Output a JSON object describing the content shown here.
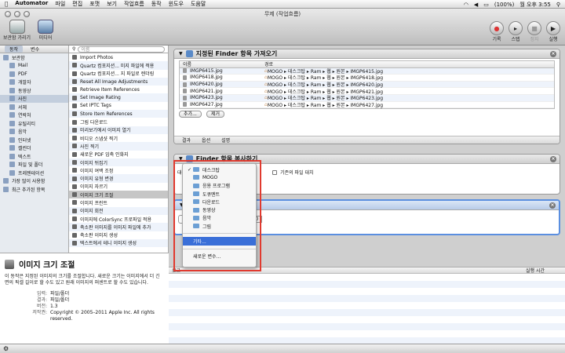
{
  "menubar": {
    "apple": "",
    "items": [
      "Automator",
      "파일",
      "편집",
      "포맷",
      "보기",
      "작업흐름",
      "동작",
      "윈도우",
      "도움말"
    ],
    "battery": "(100%)",
    "clock": "월 오후 3:55"
  },
  "window": {
    "title": "무제 (작업흐름)",
    "toolbar_left": [
      "보관함 가리기",
      "미디어"
    ],
    "toolbar_right": [
      "기록",
      "스텝",
      "정지",
      "실행"
    ]
  },
  "library": {
    "tabs": [
      "동작",
      "변수"
    ],
    "search_placeholder": "이름",
    "items": [
      {
        "label": "보관함",
        "indent": 0
      },
      {
        "label": "Mail",
        "indent": 1
      },
      {
        "label": "PDF",
        "indent": 1
      },
      {
        "label": "개발자",
        "indent": 1
      },
      {
        "label": "동영상",
        "indent": 1
      },
      {
        "label": "사진",
        "indent": 1,
        "selected": true
      },
      {
        "label": "서체",
        "indent": 1
      },
      {
        "label": "연락처",
        "indent": 1
      },
      {
        "label": "유틸리티",
        "indent": 1
      },
      {
        "label": "음악",
        "indent": 1
      },
      {
        "label": "인터넷",
        "indent": 1
      },
      {
        "label": "캘린더",
        "indent": 1
      },
      {
        "label": "텍스트",
        "indent": 1
      },
      {
        "label": "파일 및 폴더",
        "indent": 1
      },
      {
        "label": "프레젠테이션",
        "indent": 1
      },
      {
        "label": "가장 많이 사용함",
        "indent": 0
      },
      {
        "label": "최근 추가된 항목",
        "indent": 0
      }
    ]
  },
  "actions": [
    "Import Photos",
    "Quartz 컴포지션... 미지 파일에 적용",
    "Quartz 컴포지션... 지 파일로 렌더링",
    "Reset All Image Adjustments",
    "Retrieve Item References",
    "Set Image Rating",
    "Set IPTC Tags",
    "Store Item References",
    "그림 다운로드",
    "미리보기에서 이미지 열기",
    "비디오 스냅샷 찍기",
    "사진 찍기",
    "새로운 PDF 임축 인화지",
    "이미지 뒤집기",
    "이미지 여백 조정",
    "이미지 유형 변경",
    "이미지 자르기",
    "이미지 크기 조절",
    "이미지 프린트",
    "이미지 회전",
    "이미지에 ColorSync 프로파일 적용",
    "축소판 이미지를 이미지 파일에 추가",
    "축소판 이미지 생성",
    "텍스트에서 테니 이미지 생성"
  ],
  "selected_action_index": 17,
  "description": {
    "title": "이미지 크기 조절",
    "text": "이 동작은 지정된 이미지의 크기를 조절합니다. 새로운 크기는 이미지에서 더 긴 면의 픽셀 길이로 할 수도 있고 원래 이미지의 퍼센트로 할 수도 있습니다.",
    "rows": [
      {
        "k": "입력:",
        "v": "파일/폴더"
      },
      {
        "k": "결과:",
        "v": "파일/폴더"
      },
      {
        "k": "버전:",
        "v": "1.3"
      },
      {
        "k": "저작권:",
        "v": "Copyright © 2005–2011 Apple Inc. All rights reserved."
      }
    ]
  },
  "panel1": {
    "title": "지정된 Finder 항목 가져오기",
    "col_name": "이름",
    "col_path": "경로",
    "rows": [
      {
        "name": "IMGP6415.jpg",
        "path": "MOGO ▸ 데스크탑 ▸ Ram ▸ 웹 ▸ 원본 ▸ IMGP6415.jpg"
      },
      {
        "name": "IMGP6418.jpg",
        "path": "MOGO ▸ 데스크탑 ▸ Ram ▸ 웹 ▸ 원본 ▸ IMGP6418.jpg"
      },
      {
        "name": "IMGP6420.jpg",
        "path": "MOGO ▸ 데스크탑 ▸ Ram ▸ 웹 ▸ 원본 ▸ IMGP6420.jpg"
      },
      {
        "name": "IMGP6421.jpg",
        "path": "MOGO ▸ 데스크탑 ▸ Ram ▸ 웹 ▸ 원본 ▸ IMGP6421.jpg"
      },
      {
        "name": "IMGP6423.jpg",
        "path": "MOGO ▸ 데스크탑 ▸ Ram ▸ 웹 ▸ 원본 ▸ IMGP6423.jpg"
      },
      {
        "name": "IMGP6427.jpg",
        "path": "MOGO ▸ 데스크탑 ▸ Ram ▸ 웹 ▸ 원본 ▸ IMGP6427.jpg"
      }
    ],
    "add_btn": "추가...",
    "remove_btn": "제거",
    "footer": [
      "결과",
      "옵션",
      "설명"
    ]
  },
  "panel2": {
    "title": "Finder 항목 복사하기",
    "target_label": "대상:",
    "replace_label": "기존의 파일 대치"
  },
  "panel3": {
    "field1": "크",
    "field2": "0"
  },
  "dropdown": {
    "items": [
      {
        "label": "데스크탑",
        "checked": true,
        "folder": true
      },
      {
        "label": "MOGO",
        "folder": true
      },
      {
        "label": "응용 프로그램",
        "folder": true
      },
      {
        "label": "도큐멘트",
        "folder": true
      },
      {
        "label": "다운로드",
        "folder": true
      },
      {
        "label": "동영상",
        "folder": true
      },
      {
        "label": "음악",
        "folder": true
      },
      {
        "label": "그림",
        "folder": true
      },
      {
        "label": "",
        "separator": true
      },
      {
        "label": "기타...",
        "highlight": true
      },
      {
        "label": "",
        "separator": true
      },
      {
        "label": "새로운 변수...",
        "folder": false
      }
    ]
  },
  "log": {
    "col_log": "로그",
    "col_time": "실행 시간"
  },
  "colors": {
    "accent": "#3a6fd8",
    "highlight_box": "#e03a2f"
  }
}
